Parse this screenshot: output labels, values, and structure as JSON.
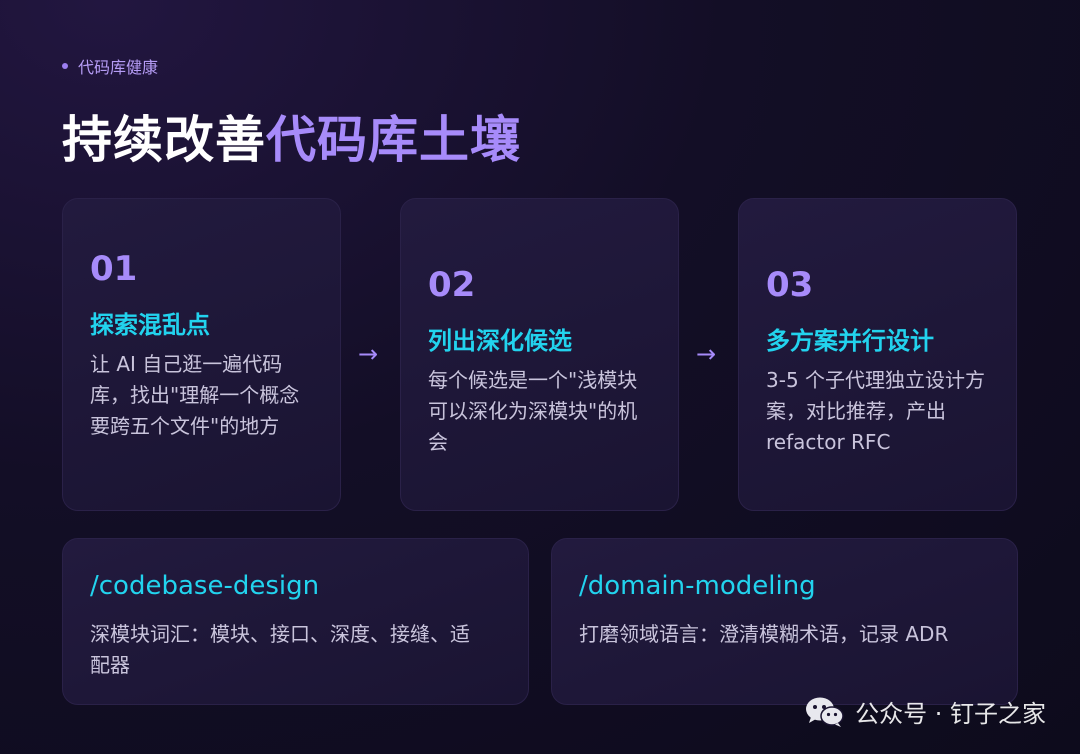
{
  "eyebrow": "代码库健康",
  "title": {
    "part1": "持续改善",
    "part2": "代码库土壤"
  },
  "steps": [
    {
      "num": "01",
      "heading": "探索混乱点",
      "desc": "让 AI 自己逛一遍代码库，找出\"理解一个概念要跨五个文件\"的地方"
    },
    {
      "num": "02",
      "heading": "列出深化候选",
      "desc": "每个候选是一个\"浅模块可以深化为深模块\"的机会"
    },
    {
      "num": "03",
      "heading": "多方案并行设计",
      "desc": "3-5 个子代理独立设计方案，对比推荐，产出 refactor RFC"
    }
  ],
  "arrow": "→",
  "commands": [
    {
      "name": "/codebase-design",
      "desc": "深模块词汇：模块、接口、深度、接缝、适配器"
    },
    {
      "name": "/domain-modeling",
      "desc": "打磨领域语言：澄清模糊术语，记录 ADR"
    }
  ],
  "watermark": "公众号 · 钉子之家",
  "colors": {
    "accent": "#a78bfa",
    "cyan": "#22d3ee",
    "background": "#130e26"
  },
  "icons": {
    "watermark": "wechat-icon",
    "eyebrow": "dot-icon"
  }
}
